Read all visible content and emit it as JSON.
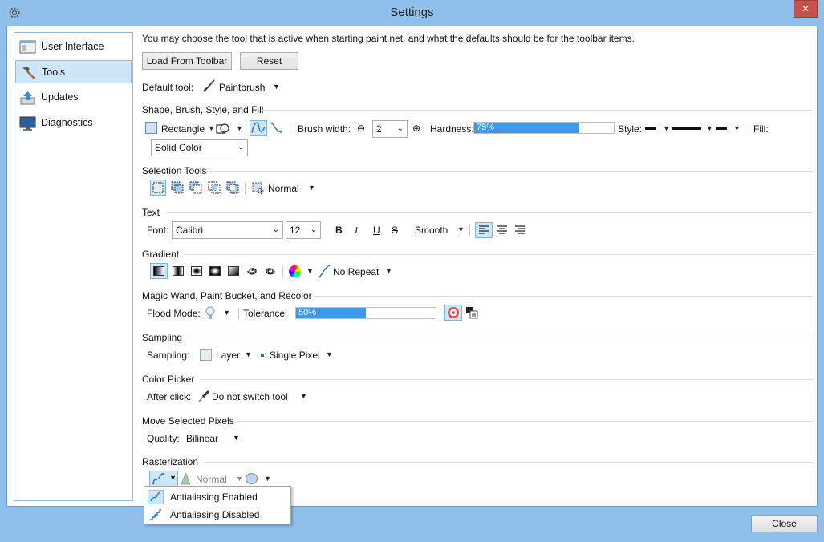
{
  "window": {
    "title": "Settings",
    "close_glyph": "✕",
    "close_button": "Close"
  },
  "nav": {
    "items": [
      {
        "label": "User Interface",
        "icon": "window-icon"
      },
      {
        "label": "Tools",
        "icon": "hammer-icon"
      },
      {
        "label": "Updates",
        "icon": "update-icon"
      },
      {
        "label": "Diagnostics",
        "icon": "monitor-icon"
      }
    ],
    "selected": "Tools"
  },
  "intro": "You may choose the tool that is active when starting paint.net, and what the defaults should be for the toolbar items.",
  "buttons": {
    "load": "Load From Toolbar",
    "reset": "Reset"
  },
  "default_tool": {
    "label": "Default tool:",
    "value": "Paintbrush"
  },
  "shape": {
    "heading": "Shape, Brush, Style, and Fill",
    "shape_value": "Rectangle",
    "brush_width_label": "Brush width:",
    "brush_width": "2",
    "hardness_label": "Hardness:",
    "hardness": "75%",
    "hardness_fraction": 0.75,
    "style_label": "Style:",
    "fill_label": "Fill:",
    "fill_value": "Solid Color"
  },
  "selection": {
    "heading": "Selection Tools",
    "mode": "Normal"
  },
  "text": {
    "heading": "Text",
    "font_label": "Font:",
    "font": "Calibri",
    "size": "12",
    "bold": "B",
    "italic": "I",
    "underline": "U",
    "strike": "S",
    "rendering": "Smooth"
  },
  "gradient": {
    "heading": "Gradient",
    "repeat": "No Repeat"
  },
  "magic": {
    "heading": "Magic Wand, Paint Bucket, and Recolor",
    "flood_label": "Flood Mode:",
    "tolerance_label": "Tolerance:",
    "tolerance": "50%",
    "tolerance_fraction": 0.5
  },
  "sampling": {
    "heading": "Sampling",
    "label": "Sampling:",
    "layer": "Layer",
    "pixel": "Single Pixel"
  },
  "color_picker": {
    "heading": "Color Picker",
    "label": "After click:",
    "value": "Do not switch tool"
  },
  "move": {
    "heading": "Move Selected Pixels",
    "label": "Quality:",
    "value": "Bilinear"
  },
  "raster": {
    "heading": "Rasterization",
    "blend": "Normal"
  },
  "antialias_menu": {
    "items": [
      "Antialiasing Enabled",
      "Antialiasing Disabled"
    ],
    "selected": "Antialiasing Enabled"
  },
  "colors": {
    "accent": "#3e99eb",
    "selection_bg": "#cde6f8",
    "window_frame": "#8fc0ec",
    "close_red": "#c7504c"
  }
}
